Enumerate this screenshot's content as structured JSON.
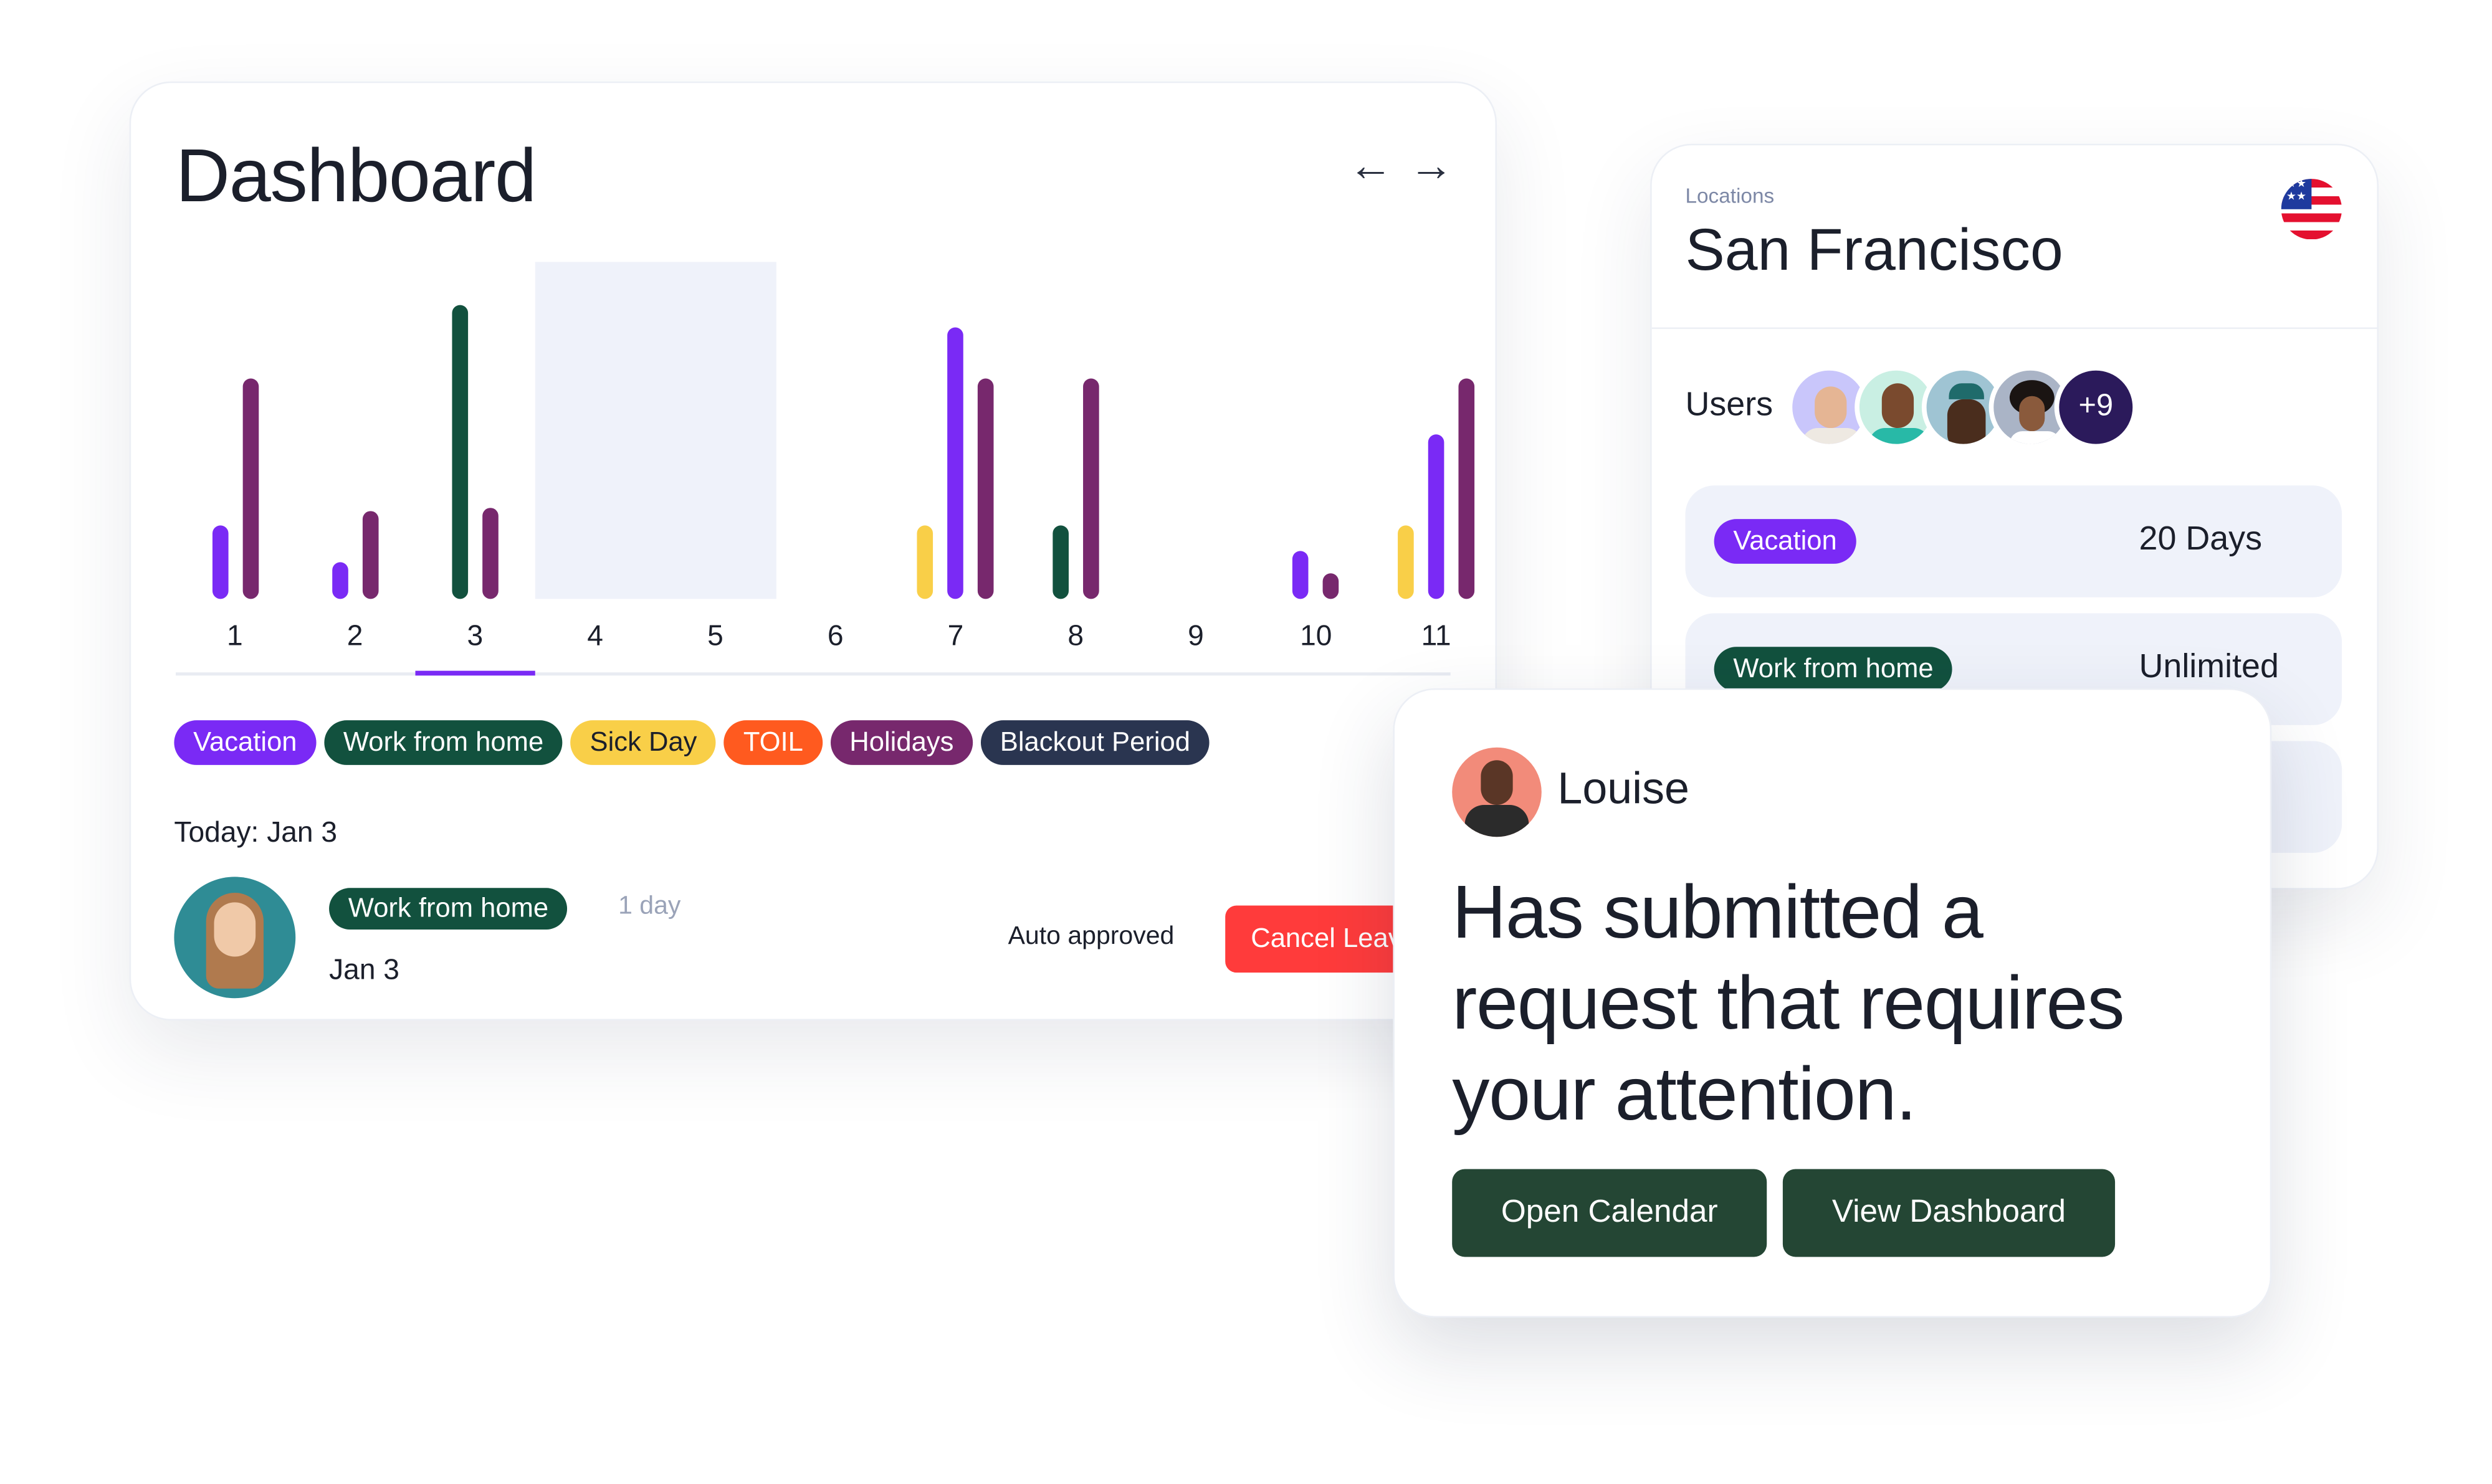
{
  "dashboard": {
    "title": "Dashboard",
    "prev_icon": "arrow-left-icon",
    "next_icon": "arrow-right-icon",
    "chart_data": {
      "type": "bar",
      "categories": [
        "1",
        "2",
        "3",
        "4",
        "5",
        "6",
        "7",
        "8",
        "9",
        "10",
        "11"
      ],
      "selected_category": "3",
      "shaded_categories": [
        "4",
        "5"
      ],
      "grid": false,
      "days": [
        {
          "label": "1",
          "bars": [
            {
              "type": "Vacation",
              "value": 1
            },
            {
              "type": "Holidays",
              "value": 3
            }
          ]
        },
        {
          "label": "2",
          "bars": [
            {
              "type": "Vacation",
              "value": 0.5
            },
            {
              "type": "Holidays",
              "value": 1.2
            }
          ]
        },
        {
          "label": "3",
          "bars": [
            {
              "type": "Work from home",
              "value": 4
            },
            {
              "type": "Holidays",
              "value": 1.25
            }
          ]
        },
        {
          "label": "4",
          "bars": []
        },
        {
          "label": "5",
          "bars": []
        },
        {
          "label": "6",
          "bars": []
        },
        {
          "label": "7",
          "bars": [
            {
              "type": "Sick Day",
              "value": 1
            },
            {
              "type": "Vacation",
              "value": 3.7
            },
            {
              "type": "Holidays",
              "value": 3
            }
          ]
        },
        {
          "label": "8",
          "bars": [
            {
              "type": "Work from home",
              "value": 1
            },
            {
              "type": "Holidays",
              "value": 3
            }
          ]
        },
        {
          "label": "9",
          "bars": []
        },
        {
          "label": "10",
          "bars": [
            {
              "type": "Vacation",
              "value": 0.65
            },
            {
              "type": "Holidays",
              "value": 0.35
            }
          ]
        },
        {
          "label": "11",
          "bars": [
            {
              "type": "Sick Day",
              "value": 1
            },
            {
              "type": "Vacation",
              "value": 2.25
            },
            {
              "type": "Holidays",
              "value": 3
            }
          ]
        }
      ]
    },
    "legend": [
      {
        "label": "Vacation",
        "color": "#7a2af5"
      },
      {
        "label": "Work from home",
        "color": "#12513e"
      },
      {
        "label": "Sick Day",
        "color": "#f9cf48",
        "text_color": "#1b1f2b"
      },
      {
        "label": "TOIL",
        "color": "#ff5a1f"
      },
      {
        "label": "Holidays",
        "color": "#77286d"
      },
      {
        "label": "Blackout Period",
        "color": "#2a3550"
      }
    ],
    "today_label": "Today: Jan 3",
    "entry": {
      "type": "Work from home",
      "duration": "1 day",
      "date": "Jan 3",
      "status": "Auto approved",
      "cancel_label": "Cancel Leave"
    }
  },
  "location": {
    "label": "Locations",
    "city": "San Francisco",
    "flag_icon": "us-flag-icon",
    "users_label": "Users",
    "more_users": "+9",
    "allowances": [
      {
        "type": "Vacation",
        "amount": "20 Days",
        "color": "#7a2af5"
      },
      {
        "type": "Work from home",
        "amount": "Unlimited",
        "color": "#12513e"
      }
    ]
  },
  "notification": {
    "user": "Louise",
    "message": "Has submitted a request that requires your attention.",
    "open_calendar": "Open Calendar",
    "view_dashboard": "View Dashboard"
  }
}
